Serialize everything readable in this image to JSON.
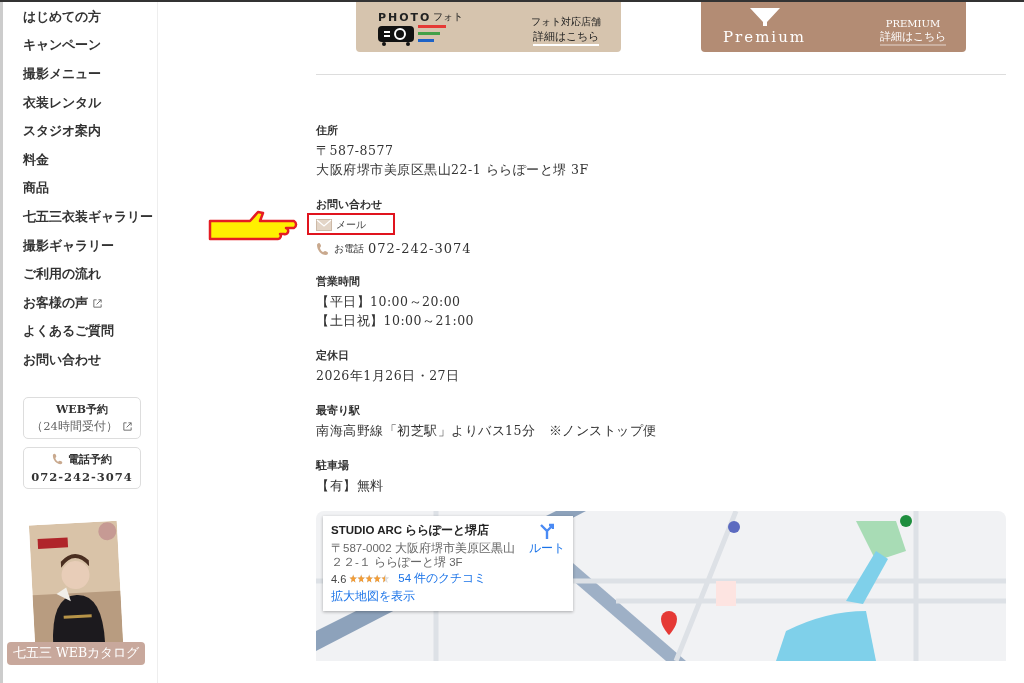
{
  "sidebar": {
    "items": [
      {
        "label": "はじめての方",
        "external": false
      },
      {
        "label": "キャンペーン",
        "external": false
      },
      {
        "label": "撮影メニュー",
        "external": false
      },
      {
        "label": "衣装レンタル",
        "external": false
      },
      {
        "label": "スタジオ案内",
        "external": false
      },
      {
        "label": "料金",
        "external": false
      },
      {
        "label": "商品",
        "external": false
      },
      {
        "label": "七五三衣装ギャラリー",
        "external": false
      },
      {
        "label": "撮影ギャラリー",
        "external": false
      },
      {
        "label": "ご利用の流れ",
        "external": false
      },
      {
        "label": "お客様の声",
        "external": true
      },
      {
        "label": "よくあるご質問",
        "external": false
      },
      {
        "label": "お問い合わせ",
        "external": false
      }
    ],
    "web_booking": {
      "title": "WEB予約",
      "note": "（24時間受付）"
    },
    "phone_booking": {
      "title": "電話予約",
      "number": "072-242-3074"
    },
    "catalog": {
      "kind": "picture",
      "label": "七五三 WEBカタログ"
    }
  },
  "banners": [
    {
      "logo": "PHOTO",
      "logo_sub": "フォト",
      "text": "フォト対応店舗",
      "link": "詳細はこちら"
    },
    {
      "kind": "premium",
      "logo": "Premium",
      "text": "PREMIUM",
      "link": "詳細はこちら"
    }
  ],
  "sections": [
    {
      "label": "住所",
      "items": [
        {
          "kind": "text",
          "text": "〒587-8577"
        },
        {
          "kind": "text",
          "text": "大阪府堺市美原区黒山22-1 ららぽーと堺 3F"
        }
      ]
    },
    {
      "label": "お問い合わせ",
      "items": [
        {
          "kind": "mail",
          "text": "メール",
          "highlighted": true
        },
        {
          "kind": "phone",
          "text": "お電話",
          "number": "072-242-3074"
        }
      ]
    },
    {
      "label": "営業時間",
      "items": [
        {
          "kind": "text",
          "text": "【平日】10:00～20:00"
        },
        {
          "kind": "text",
          "text": "【土日祝】10:00～21:00"
        }
      ]
    },
    {
      "label": "定休日",
      "items": [
        {
          "kind": "text",
          "text": "2026年1月26日・27日"
        }
      ]
    },
    {
      "label": "最寄り駅",
      "items": [
        {
          "kind": "text",
          "text": "南海高野線「初芝駅」よりバス15分　※ノンストップ便"
        }
      ]
    },
    {
      "label": "駐車場",
      "items": [
        {
          "kind": "text",
          "text": "【有】無料"
        }
      ]
    }
  ],
  "map": {
    "kind": "picture",
    "card": {
      "title": "STUDIO ARC ららぽーと堺店",
      "address": "〒587-0002 大阪府堺市美原区黒山２２-１ ららぽーと堺 3F",
      "route": "ルート",
      "rating": "4.6",
      "stars": 4.5,
      "reviews": "54 件のクチコミ",
      "larger_map": "拡大地図を表示"
    }
  }
}
